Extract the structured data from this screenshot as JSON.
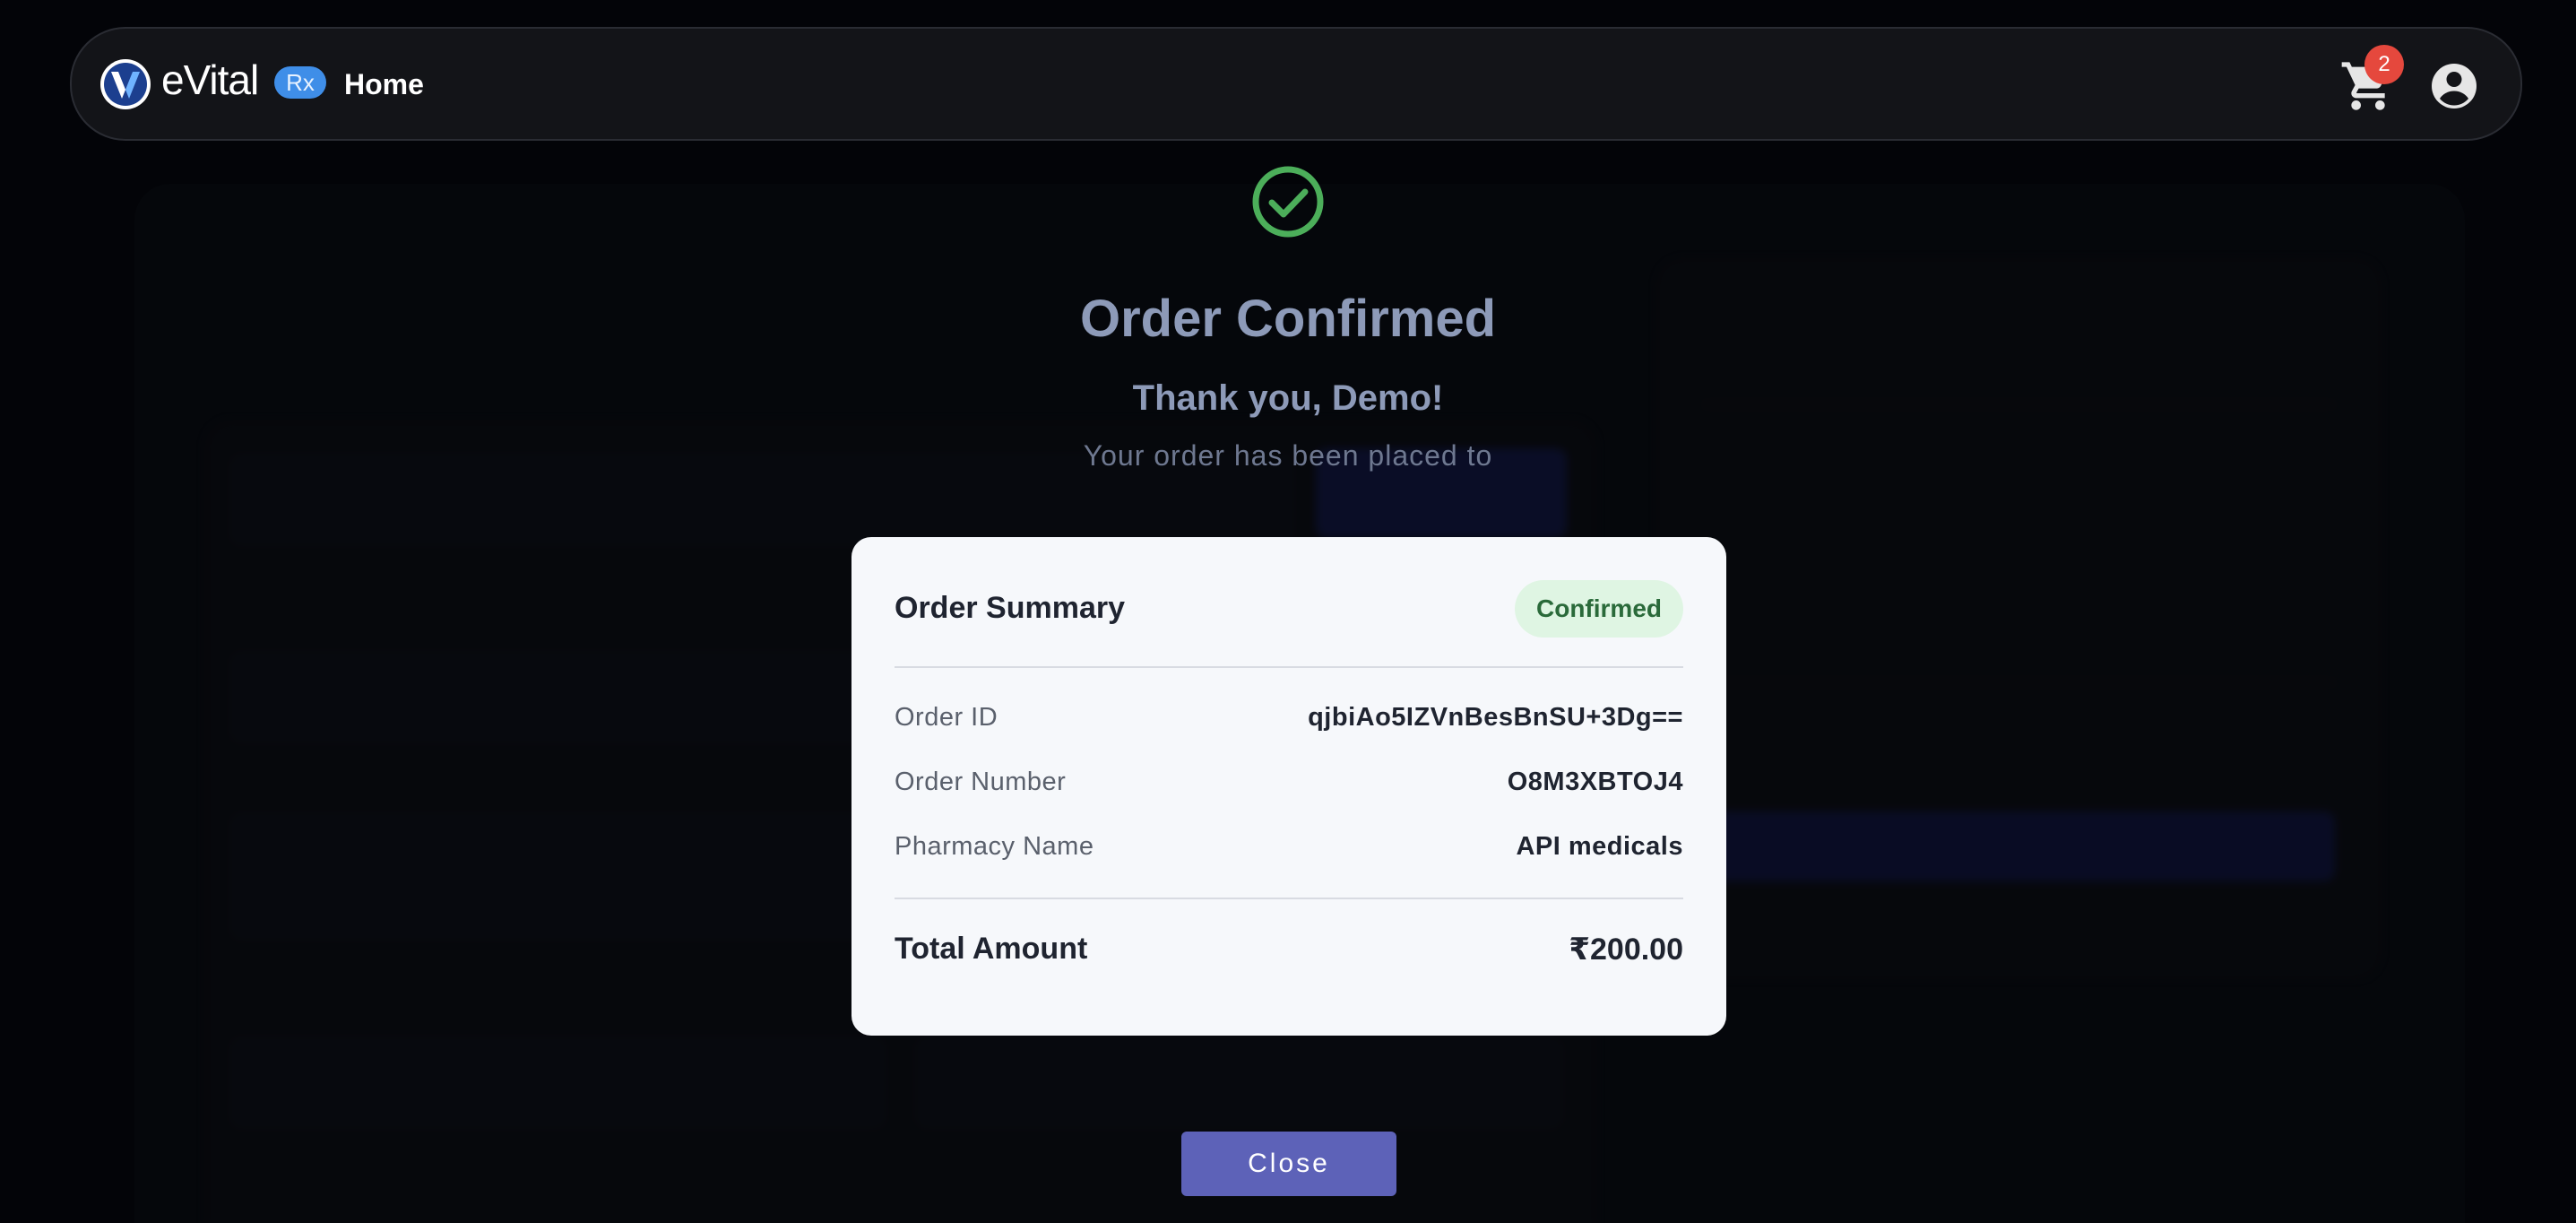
{
  "navbar": {
    "logo_text": "eVital",
    "logo_badge": "Rx",
    "home_label": "Home",
    "cart_count": "2",
    "icons": [
      "logo-icon",
      "cart-icon",
      "account-circle-icon"
    ]
  },
  "confirmation": {
    "title": "Order Confirmed",
    "thank_you": "Thank you, Demo!",
    "placed_text": "Your order has been placed to",
    "icon": "check-circle-icon",
    "icon_color": "#4cae5a"
  },
  "modal": {
    "title": "Order Summary",
    "status": "Confirmed",
    "rows": [
      {
        "label": "Order ID",
        "value": "qjbiAo5IZVnBesBnSU+3Dg=="
      },
      {
        "label": "Order Number",
        "value": "O8M3XBTOJ4"
      },
      {
        "label": "Pharmacy Name",
        "value": "API medicals"
      }
    ],
    "total_label": "Total Amount",
    "total_value": "₹200.00"
  },
  "close_label": "Close",
  "colors": {
    "accent": "#5d62b8",
    "success": "#4cae5a",
    "badge_red": "#e5483d"
  }
}
